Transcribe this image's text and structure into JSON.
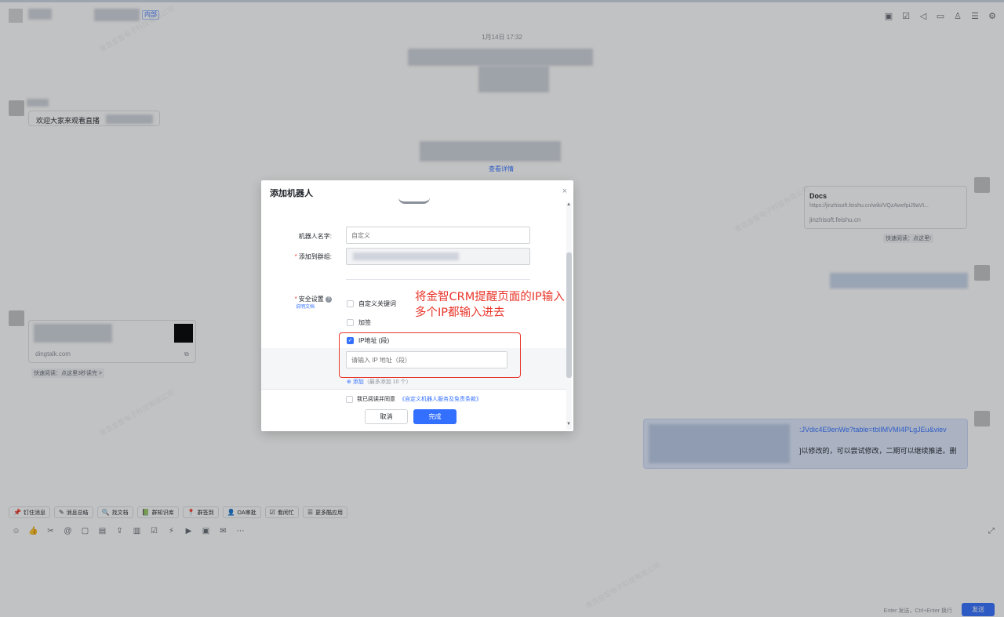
{
  "chat": {
    "inner_tag": "内部",
    "timestamp": "1月14日 17:32",
    "welcome_message": "欢迎大家来观看直播",
    "see_detail": "查看详情",
    "docs_card": {
      "title": "Docs",
      "url": "https://jinzhisoft.feishu.cn/wiki/VQzAwefpiJ9aVt...",
      "domain": "jinzhisoft.feishu.cn",
      "quick_read": "快速阅读：点这里!"
    },
    "dingtalk_card": {
      "domain": "dingtalk.com",
      "quick_read": "快速阅读：点这里3秒读完 >"
    },
    "right_message": {
      "link": ":JVdic4E9enWe?table=tblIMVMI4PLgJEu&viev",
      "text": "]以修改的，可以尝试修改，二期可以继续推进。删"
    }
  },
  "app_bar": [
    {
      "icon": "pin-icon",
      "glyph": "📌",
      "label": "钉住消息"
    },
    {
      "icon": "summary-icon",
      "glyph": "✎",
      "label": "消息总结"
    },
    {
      "icon": "find-doc-icon",
      "glyph": "🔍",
      "label": "找文档"
    },
    {
      "icon": "knowledge-icon",
      "glyph": "📗",
      "label": "群知识库"
    },
    {
      "icon": "signin-icon",
      "glyph": "📍",
      "label": "群签到"
    },
    {
      "icon": "oa-icon",
      "glyph": "👤",
      "label": "OA审批"
    },
    {
      "icon": "busy-icon",
      "glyph": "☑",
      "label": "看闲忙"
    },
    {
      "icon": "more-apps-icon",
      "glyph": "☰",
      "label": "更多酷应用"
    }
  ],
  "input": {
    "enter_hint": "Enter 发送，Ctrl+Enter 换行",
    "send_label": "发送"
  },
  "dialog": {
    "title": "添加机器人",
    "close": "×",
    "name_label": "机器人名字:",
    "name_placeholder": "自定义",
    "group_label": "添加到群组:",
    "security_label": "安全设置",
    "doc_link": "说明文档",
    "opt_keyword": "自定义关键词",
    "opt_sign": "加签",
    "opt_ip": "IP地址 (段)",
    "ip_placeholder": "请输入 IP 地址（段）",
    "add_label": "添加",
    "add_max": "（最多添加 10 个）",
    "agree_prefix": "我已阅读并同意",
    "agree_link": "《自定义机器人服务及免责条款》",
    "cancel": "取消",
    "done": "完成"
  },
  "annotation": {
    "line1": "将金智CRM提醒页面的IP输入",
    "line2": "多个IP都输入进去",
    "color": "#e8362b"
  },
  "colors": {
    "accent": "#3370ff",
    "required": "#f54a45"
  }
}
